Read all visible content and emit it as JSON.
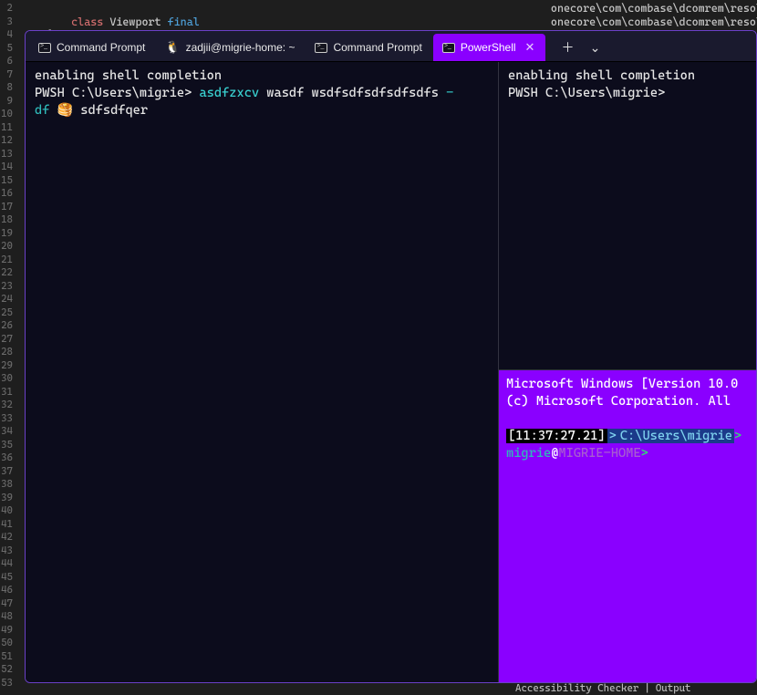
{
  "editor": {
    "line_numbers": [
      2,
      3,
      4,
      5,
      6,
      7,
      8,
      9,
      10,
      11,
      12,
      13,
      14,
      15,
      16,
      17,
      18,
      19,
      20,
      21,
      22,
      23,
      24,
      25,
      26,
      27,
      28,
      29,
      30,
      31,
      32,
      33,
      34,
      35,
      36,
      37,
      38,
      39,
      40,
      41,
      42,
      43,
      44,
      45,
      46,
      47,
      48,
      49,
      50,
      51,
      52,
      53
    ],
    "code_kw_class": "class",
    "code_class_name": " Viewport ",
    "code_kw_final": "final",
    "code_brace": "{",
    "path1": "onecore\\com\\combase\\dcomrem\\resolve",
    "path2": "onecore\\com\\combase\\dcomrem\\resolve"
  },
  "status": {
    "accessibility": "Accessibility Checker",
    "output": "Output"
  },
  "tabs": {
    "t1": "Command Prompt",
    "t2": "zadjii@migrie-home: ~",
    "t3": "Command Prompt",
    "t4": "PowerShell"
  },
  "pane_left": {
    "l1": "enabling shell completion",
    "prompt": "PWSH C:\\Users\\migrie> ",
    "cmd_cyan1": "asdfzxcv",
    "cmd_rest1": " wasdf wsdfsdfsdfsdfsdfs ",
    "cmd_cont_dash": "-",
    "cmd_cont_df": "df ",
    "emoji": "🥞",
    "cmd_cont2": " sdfsdfqer"
  },
  "pane_rt": {
    "l1": "enabling shell completion",
    "prompt": "PWSH C:\\Users\\migrie>"
  },
  "pane_rb": {
    "l1": "Microsoft Windows [Version 10.0",
    "l2": "(c) Microsoft Corporation. All",
    "time": "[11:37:27.21]",
    "arrow": ">",
    "path": "C:\\Users\\migrie",
    "arrow2": ">",
    "user": "migrie",
    "at": "@",
    "host": "MIGRIE-HOME",
    "arrow3": ">"
  }
}
